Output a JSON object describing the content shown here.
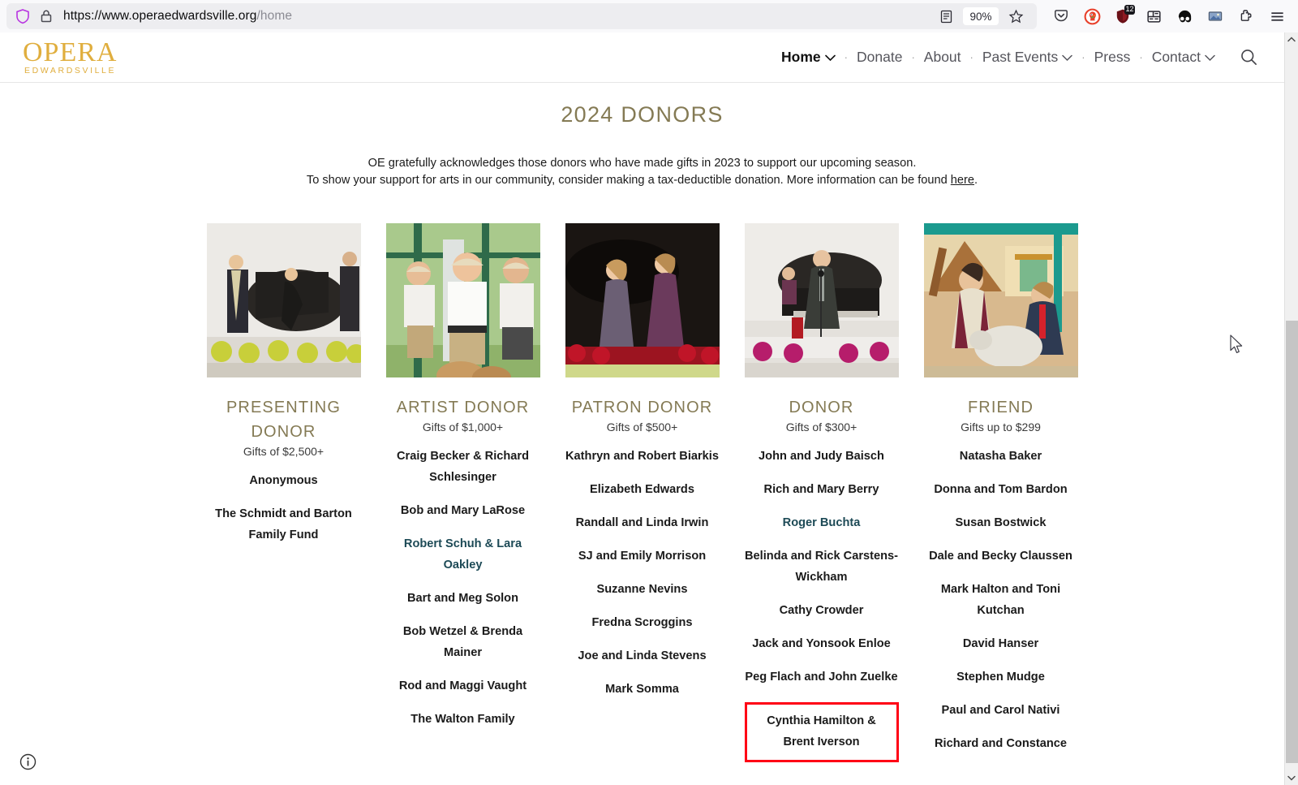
{
  "browser": {
    "url_main": "https://www.operaedwardsville.org",
    "url_path": "/home",
    "zoom_level": "90%",
    "shield_icon": "shield-icon",
    "lock_icon": "lock-icon",
    "reader_icon": "reader-view-icon",
    "bookmark_icon": "bookmark-star-icon",
    "pocket_icon": "save-to-pocket-icon",
    "duckduckgo_icon": "duckduckgo-privacy-icon",
    "ublock_icon": "ublock-origin-icon",
    "ublock_badge": "12",
    "container_icon": "multi-account-containers-icon",
    "dark_reader_icon": "dark-reader-icon",
    "screenshot_icon": "screenshot-extension-icon",
    "puzzle_icon": "extensions-puzzle-icon",
    "menu_icon": "app-menu-icon"
  },
  "site": {
    "logo_word": "OPERA",
    "logo_sub": "EDWARDSVILLE",
    "nav": [
      {
        "label": "Home",
        "has_chevron": true,
        "active": true
      },
      {
        "label": "Donate",
        "has_chevron": false,
        "active": false
      },
      {
        "label": "About",
        "has_chevron": false,
        "active": false
      },
      {
        "label": "Past Events",
        "has_chevron": true,
        "active": false
      },
      {
        "label": "Press",
        "has_chevron": false,
        "active": false
      },
      {
        "label": "Contact",
        "has_chevron": true,
        "active": false
      }
    ],
    "search_icon": "search-icon"
  },
  "main": {
    "title": "2024 DONORS",
    "intro_line1": "OE gratefully acknowledges those donors who have made gifts in 2023 to support our upcoming season.",
    "intro_line2_pre": "To show your support for arts in our community, consider making a tax-deductible donation. More information can be found ",
    "intro_link": "here",
    "intro_line2_post": ".",
    "accent_color": "#847a54",
    "link_color": "#1d4a56",
    "highlight_color": "#ff0015",
    "columns": [
      {
        "tier": "PRESENTING DONOR",
        "gift": "Gifts of $2,500+",
        "photo_alt": "opera-performers-at-piano-photo",
        "donors": [
          {
            "name": "Anonymous",
            "link": false,
            "highlighted": false
          },
          {
            "name": "The Schmidt and Barton Family Fund",
            "link": false,
            "highlighted": false
          }
        ]
      },
      {
        "tier": "ARTIST  DONOR",
        "gift": "Gifts of $1,000+",
        "photo_alt": "performers-in-safari-hats-photo",
        "donors": [
          {
            "name": "Craig Becker & Richard Schlesinger",
            "link": false,
            "highlighted": false
          },
          {
            "name": "Bob and Mary LaRose",
            "link": false,
            "highlighted": false
          },
          {
            "name": "Robert Schuh & Lara Oakley",
            "link": true,
            "highlighted": false
          },
          {
            "name": "Bart and Meg Solon",
            "link": false,
            "highlighted": false
          },
          {
            "name": "Bob Wetzel & Brenda Mainer",
            "link": false,
            "highlighted": false
          },
          {
            "name": "Rod and Maggi Vaught",
            "link": false,
            "highlighted": false
          },
          {
            "name": "The Walton Family",
            "link": false,
            "highlighted": false
          }
        ]
      },
      {
        "tier": "PATRON DONOR",
        "gift": "Gifts of $500+",
        "photo_alt": "two-sopranos-on-stage-photo",
        "donors": [
          {
            "name": "Kathryn and Robert Biarkis",
            "link": false,
            "highlighted": false
          },
          {
            "name": "Elizabeth Edwards",
            "link": false,
            "highlighted": false
          },
          {
            "name": "Randall and Linda Irwin",
            "link": false,
            "highlighted": false
          },
          {
            "name": "SJ and Emily Morrison",
            "link": false,
            "highlighted": false
          },
          {
            "name": "Suzanne Nevins",
            "link": false,
            "highlighted": false
          },
          {
            "name": "Fredna Scroggins",
            "link": false,
            "highlighted": false
          },
          {
            "name": "Joe and Linda Stevens",
            "link": false,
            "highlighted": false
          },
          {
            "name": "Mark Somma",
            "link": false,
            "highlighted": false
          }
        ]
      },
      {
        "tier": "DONOR",
        "gift": "Gifts of $300+",
        "photo_alt": "baritone-singing-at-piano-photo",
        "donors": [
          {
            "name": "John and Judy Baisch",
            "link": false,
            "highlighted": false
          },
          {
            "name": "Rich and Mary Berry",
            "link": false,
            "highlighted": false
          },
          {
            "name": "Roger Buchta",
            "link": true,
            "highlighted": false
          },
          {
            "name": "Belinda and Rick Carstens-Wickham",
            "link": false,
            "highlighted": false
          },
          {
            "name": "Cathy Crowder",
            "link": false,
            "highlighted": false
          },
          {
            "name": "Jack and Yonsook Enloe",
            "link": false,
            "highlighted": false
          },
          {
            "name": "Peg Flach and John Zuelke",
            "link": false,
            "highlighted": false
          },
          {
            "name": "Cynthia Hamilton & Brent Iverson",
            "link": false,
            "highlighted": true
          }
        ]
      },
      {
        "tier": "FRIEND",
        "gift": "Gifts up to $299",
        "photo_alt": "costumed-performers-with-sheep-prop-photo",
        "donors": [
          {
            "name": "Natasha Baker",
            "link": false,
            "highlighted": false
          },
          {
            "name": "Donna and Tom Bardon",
            "link": false,
            "highlighted": false
          },
          {
            "name": "Susan Bostwick",
            "link": false,
            "highlighted": false
          },
          {
            "name": "Dale and Becky Claussen",
            "link": false,
            "highlighted": false
          },
          {
            "name": "Mark Halton and Toni Kutchan",
            "link": false,
            "highlighted": false
          },
          {
            "name": "David Hanser",
            "link": false,
            "highlighted": false
          },
          {
            "name": "Stephen Mudge",
            "link": false,
            "highlighted": false
          },
          {
            "name": "Paul and Carol Nativi",
            "link": false,
            "highlighted": false
          },
          {
            "name": "Richard and Constance",
            "link": false,
            "highlighted": false
          }
        ]
      }
    ],
    "info_icon": "info-circle-icon"
  },
  "scrollbar": {
    "up_icon": "scroll-up-arrow-icon",
    "down_icon": "scroll-down-arrow-icon"
  }
}
